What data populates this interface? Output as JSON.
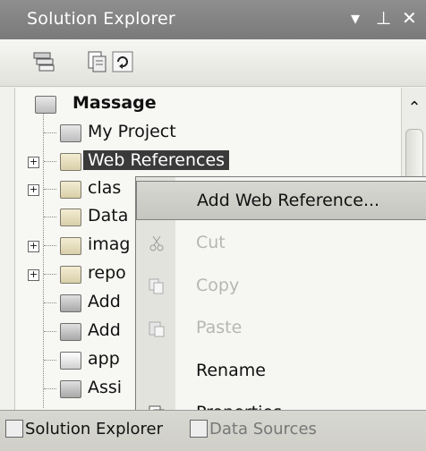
{
  "panel": {
    "title": "Solution Explorer"
  },
  "titlebar_buttons": {
    "pin_menu": "▾",
    "pin": "⊥",
    "close": "✕"
  },
  "toolbar": {
    "items": [
      {
        "icon": "show-all-files-icon"
      },
      {
        "icon": "properties-icon"
      },
      {
        "icon": "refresh-icon"
      }
    ]
  },
  "tree": {
    "root": {
      "label": "Massage",
      "icon": "project-icon"
    },
    "nodes": [
      {
        "label": "My Project",
        "icon": "my-project-icon",
        "expandable": false
      },
      {
        "label": "Web References",
        "icon": "web-references-folder-icon",
        "expandable": true,
        "selected": true
      },
      {
        "label": "clas",
        "icon": "folder-icon",
        "expandable": true
      },
      {
        "label": "Data",
        "icon": "folder-icon",
        "expandable": false
      },
      {
        "label": "imag",
        "icon": "folder-icon",
        "expandable": true
      },
      {
        "label": "repo",
        "icon": "folder-icon",
        "expandable": true
      },
      {
        "label": "Add",
        "icon": "form-icon",
        "expandable": false
      },
      {
        "label": "Add",
        "icon": "form-icon",
        "expandable": false
      },
      {
        "label": "app",
        "icon": "config-file-icon",
        "expandable": false
      },
      {
        "label": "Assi",
        "icon": "form-icon",
        "expandable": false
      }
    ]
  },
  "context_menu": {
    "items": [
      {
        "label": "Add Web Reference...",
        "enabled": true,
        "highlighted": true
      },
      {
        "label": "Cut",
        "enabled": false,
        "icon": "cut-icon"
      },
      {
        "label": "Copy",
        "enabled": false,
        "icon": "copy-icon"
      },
      {
        "label": "Paste",
        "enabled": false,
        "icon": "paste-icon"
      },
      {
        "label": "Rename",
        "enabled": true
      },
      {
        "label": "Properties",
        "enabled": true,
        "icon": "properties-icon"
      }
    ]
  },
  "bottom_tabs": [
    {
      "label": "Solution Explorer",
      "icon": "solution-explorer-icon"
    },
    {
      "label": "Data Sources",
      "icon": "data-sources-icon"
    }
  ]
}
